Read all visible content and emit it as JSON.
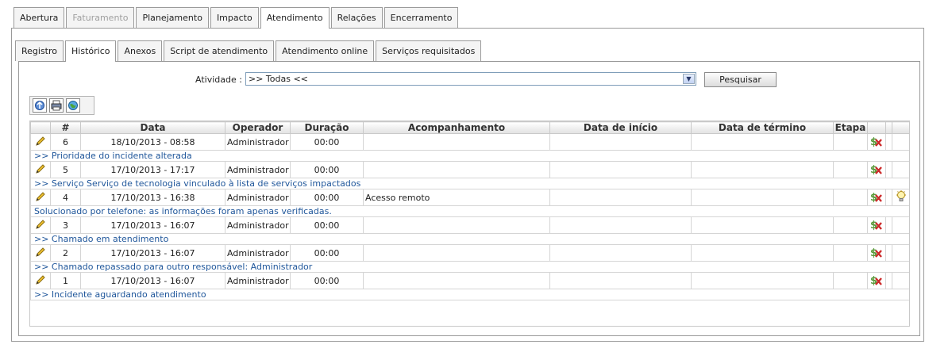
{
  "outer_tabs": [
    {
      "label": "Abertura",
      "state": "normal"
    },
    {
      "label": "Faturamento",
      "state": "disabled"
    },
    {
      "label": "Planejamento",
      "state": "normal"
    },
    {
      "label": "Impacto",
      "state": "normal"
    },
    {
      "label": "Atendimento",
      "state": "active"
    },
    {
      "label": "Relações",
      "state": "normal"
    },
    {
      "label": "Encerramento",
      "state": "normal"
    }
  ],
  "inner_tabs": [
    {
      "label": "Registro",
      "state": "normal"
    },
    {
      "label": "Histórico",
      "state": "active"
    },
    {
      "label": "Anexos",
      "state": "normal"
    },
    {
      "label": "Script de atendimento",
      "state": "normal"
    },
    {
      "label": "Atendimento online",
      "state": "normal"
    },
    {
      "label": "Serviços requisitados",
      "state": "normal"
    }
  ],
  "filter": {
    "label": "Atividade :",
    "value": ">> Todas <<",
    "search_button": "Pesquisar"
  },
  "toolbar": {
    "icons": [
      "refresh-icon",
      "print-icon",
      "globe-icon"
    ]
  },
  "table": {
    "headers": [
      "#",
      "Data",
      "Operador",
      "Duração",
      "Acompanhamento",
      "Data de início",
      "Data de término",
      "Etapa"
    ],
    "rows": [
      {
        "num": "6",
        "date": "18/10/2013 - 08:58",
        "operator": "Administrador",
        "duration": "00:00",
        "followup": "",
        "start": "",
        "end": "",
        "stage": "",
        "note": ">> Prioridade do incidente alterada",
        "idea": false
      },
      {
        "num": "5",
        "date": "17/10/2013 - 17:17",
        "operator": "Administrador",
        "duration": "00:00",
        "followup": "",
        "start": "",
        "end": "",
        "stage": "",
        "note": ">> Serviço Serviço de tecnologia vinculado à lista de serviços impactados",
        "idea": false
      },
      {
        "num": "4",
        "date": "17/10/2013 - 16:38",
        "operator": "Administrador",
        "duration": "00:00",
        "followup": "Acesso remoto",
        "start": "",
        "end": "",
        "stage": "",
        "note": "Solucionado por telefone: as informações foram apenas verificadas.",
        "idea": true
      },
      {
        "num": "3",
        "date": "17/10/2013 - 16:07",
        "operator": "Administrador",
        "duration": "00:00",
        "followup": "",
        "start": "",
        "end": "",
        "stage": "",
        "note": ">> Chamado em atendimento",
        "idea": false
      },
      {
        "num": "2",
        "date": "17/10/2013 - 16:07",
        "operator": "Administrador",
        "duration": "00:00",
        "followup": "",
        "start": "",
        "end": "",
        "stage": "",
        "note": ">> Chamado repassado para outro responsável: Administrador",
        "idea": false
      },
      {
        "num": "1",
        "date": "17/10/2013 - 16:07",
        "operator": "Administrador",
        "duration": "00:00",
        "followup": "",
        "start": "",
        "end": "",
        "stage": "",
        "note": ">> Incidente aguardando atendimento",
        "idea": false
      }
    ]
  },
  "colors": {
    "border": "#9a9a9a",
    "link": "#20579b",
    "cost_icon": "#5a9a3a",
    "remove_icon": "#cc2a2a"
  }
}
